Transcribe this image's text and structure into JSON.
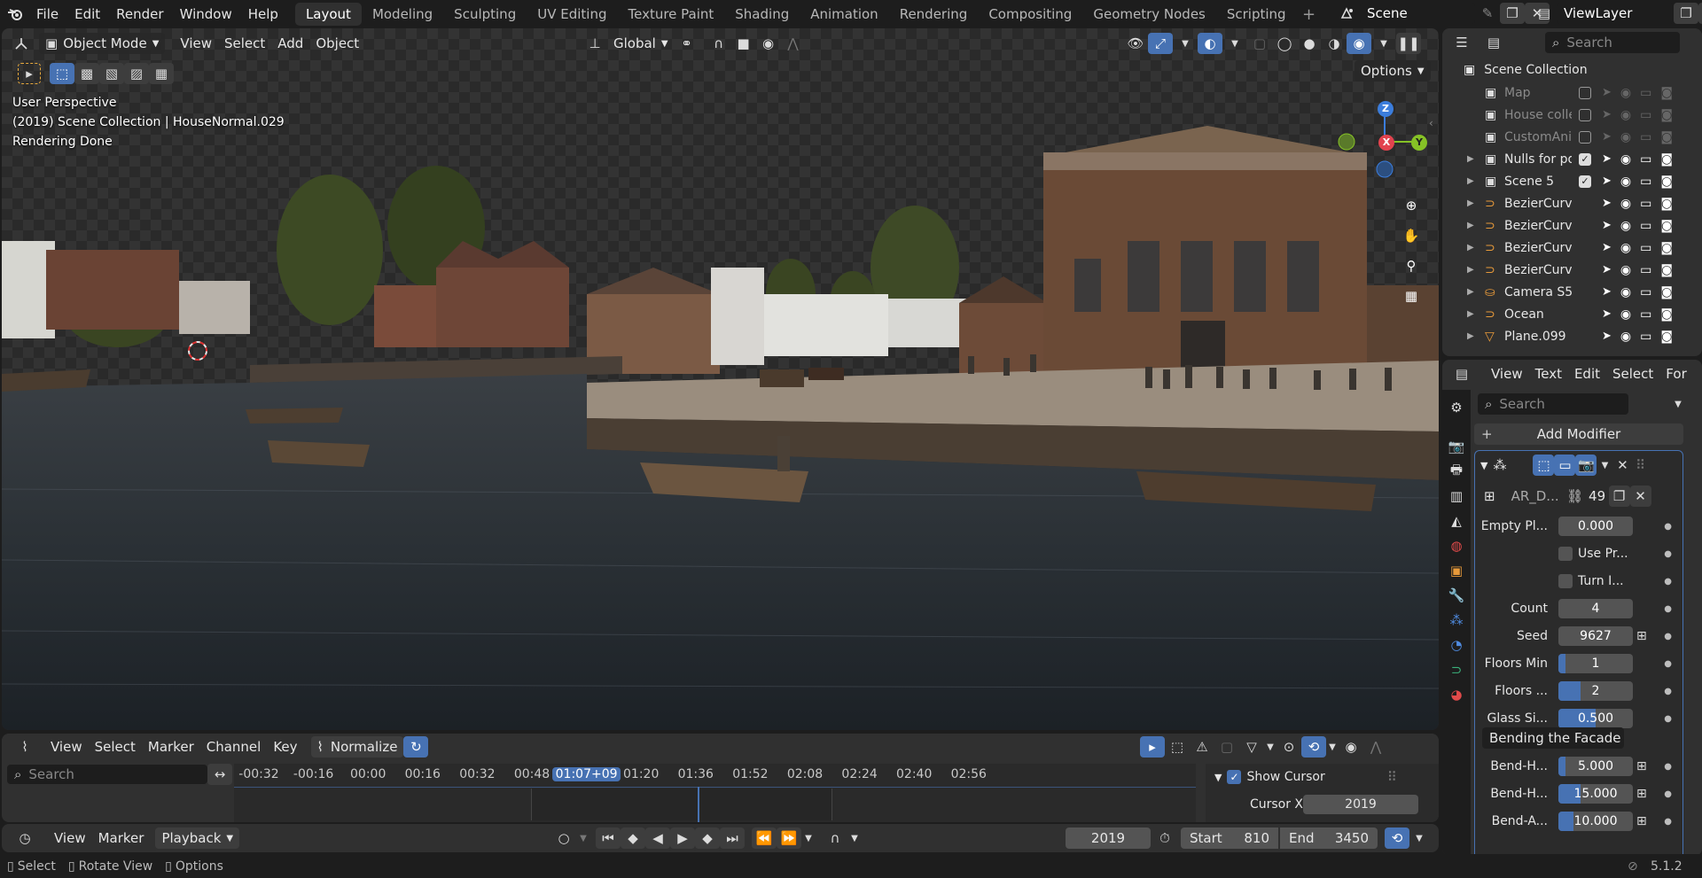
{
  "topbar": {
    "menus": [
      "File",
      "Edit",
      "Render",
      "Window",
      "Help"
    ],
    "workspaces": [
      "Layout",
      "Modeling",
      "Sculpting",
      "UV Editing",
      "Texture Paint",
      "Shading",
      "Animation",
      "Rendering",
      "Compositing",
      "Geometry Nodes",
      "Scripting"
    ],
    "active_workspace": "Layout",
    "scene_name": "Scene",
    "view_layer": "ViewLayer"
  },
  "viewport": {
    "mode": "Object Mode",
    "menus": [
      "View",
      "Select",
      "Add",
      "Object"
    ],
    "transform_orientation": "Global",
    "options_label": "Options",
    "overlay_lines": [
      "User Perspective",
      "(2019) Scene Collection | HouseNormal.029",
      "Rendering Done"
    ],
    "gizmo_labels": {
      "x": "X",
      "y": "Y",
      "z": "Z"
    }
  },
  "outliner": {
    "search_placeholder": "Search",
    "root": "Scene Collection",
    "items": [
      {
        "label": "Map",
        "type": "collection",
        "checked": false,
        "dimmed": true
      },
      {
        "label": "House colle",
        "type": "collection",
        "checked": false,
        "dimmed": true
      },
      {
        "label": "CustomAnir",
        "type": "collection",
        "checked": false,
        "dimmed": true
      },
      {
        "label": "Nulls for po",
        "type": "collection",
        "checked": true,
        "dimmed": false
      },
      {
        "label": "Scene 5",
        "type": "collection",
        "checked": true,
        "dimmed": false
      },
      {
        "label": "BezierCurve",
        "type": "curve",
        "checked": null,
        "dimmed": false
      },
      {
        "label": "BezierCurve",
        "type": "curve",
        "checked": null,
        "dimmed": false
      },
      {
        "label": "BezierCurve",
        "type": "curve",
        "checked": null,
        "dimmed": false
      },
      {
        "label": "BezierCurve",
        "type": "curve",
        "checked": null,
        "dimmed": false
      },
      {
        "label": "Camera S5",
        "type": "camera",
        "checked": null,
        "dimmed": false
      },
      {
        "label": "Ocean",
        "type": "curve",
        "checked": null,
        "dimmed": false
      },
      {
        "label": "Plane.099",
        "type": "mesh",
        "checked": null,
        "dimmed": false
      }
    ]
  },
  "properties": {
    "header_menus": [
      "View",
      "Text",
      "Edit",
      "Select",
      "For"
    ],
    "search_placeholder": "Search",
    "add_modifier": "Add Modifier",
    "node_group_name": "AR_D...",
    "user_count": "49",
    "rows": [
      {
        "label": "Empty Pl...",
        "value": "0.000",
        "kind": "value",
        "fill": 0
      },
      {
        "label": "Use Pr...",
        "value": "",
        "kind": "check"
      },
      {
        "label": "Turn I...",
        "value": "",
        "kind": "check"
      },
      {
        "label": "Count",
        "value": "4",
        "kind": "value",
        "fill": 0
      },
      {
        "label": "Seed",
        "value": "9627",
        "kind": "value",
        "fill": 0
      },
      {
        "label": "Floors  Min",
        "value": "1",
        "kind": "slider",
        "fill": 0.1
      },
      {
        "label": "Floors ...",
        "value": "2",
        "kind": "slider",
        "fill": 0.3
      },
      {
        "label": "Glass Si...",
        "value": "0.500",
        "kind": "slider",
        "fill": 0.5
      }
    ],
    "panel_title": "Bending the Facade",
    "bend_rows": [
      {
        "label": "Bend-H...",
        "value": "5.000",
        "fill": 0.1
      },
      {
        "label": "Bend-H...",
        "value": "15.000",
        "fill": 0.3
      },
      {
        "label": "Bend-A...",
        "value": "10.000",
        "fill": 0.2
      }
    ]
  },
  "timeline": {
    "menus": [
      "View",
      "Select",
      "Marker",
      "Channel",
      "Key"
    ],
    "normalize_label": "Normalize",
    "search_placeholder": "Search",
    "ticks": [
      "-00:32",
      "-00:16",
      "00:00",
      "00:16",
      "00:32",
      "00:48",
      "01:07+09",
      "01:20",
      "01:36",
      "01:52",
      "02:08",
      "02:24",
      "02:40",
      "02:56"
    ],
    "current_time": "01:07+09",
    "show_cursor_label": "Show Cursor",
    "cursor_x_label": "Cursor X",
    "cursor_x_value": "2019"
  },
  "playback": {
    "menus": [
      "View",
      "Marker"
    ],
    "playback_label": "Playback",
    "current_frame": "2019",
    "start_label": "Start",
    "start_value": "810",
    "end_label": "End",
    "end_value": "3450"
  },
  "statusbar": {
    "hints": [
      "Select",
      "Rotate View",
      "Options"
    ],
    "version": "5.1.2"
  },
  "colors": {
    "accent": "#4772b3",
    "axis_x": "#e2434e",
    "axis_y": "#86c226",
    "axis_z": "#3b7ddc",
    "playhead": "#4772b3"
  }
}
